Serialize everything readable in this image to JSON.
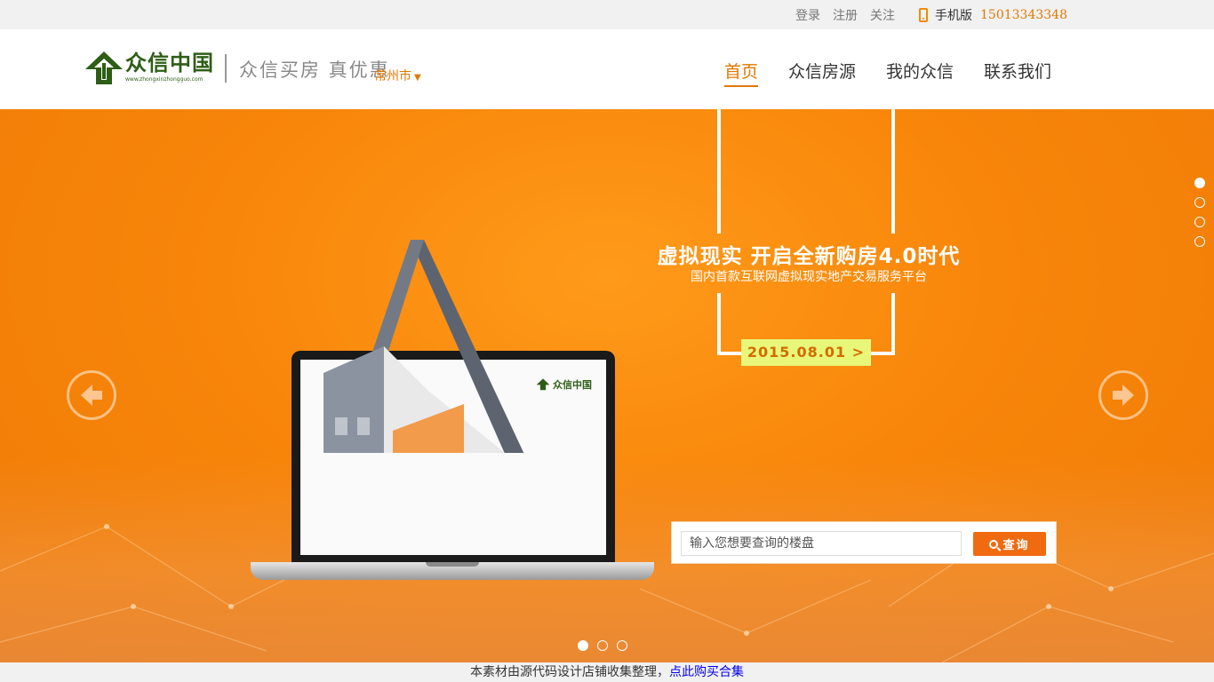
{
  "topbar": {
    "links": [
      "登录",
      "注册",
      "关注"
    ],
    "mobile_label": "手机版",
    "phone": "15013343348"
  },
  "header": {
    "logo_cn": "众信中国",
    "logo_url": "www.zhongxinzhongguo.com",
    "slogan": "众信买房  真优惠",
    "city": "常州市",
    "nav": [
      "首页",
      "众信房源",
      "我的众信",
      "联系我们"
    ],
    "active_nav": "首页"
  },
  "banner": {
    "headline": "虚拟现实  开启全新购房4.0时代",
    "subline": "国内首款互联网虚拟现实地产交易服务平台",
    "date_button": "2015.08.01 >",
    "screen_logo": "众信中国",
    "search": {
      "placeholder": "输入您想要查询的楼盘",
      "button": "查询"
    },
    "vertical_dots": 4,
    "horizontal_dots": 3,
    "colors": {
      "accent": "#f08a00",
      "banner": "#f8860a",
      "logo_green": "#2e5e16"
    }
  },
  "footer": {
    "text": "本素材由源代码设计店铺收集整理，",
    "link": "点此购买合集"
  }
}
